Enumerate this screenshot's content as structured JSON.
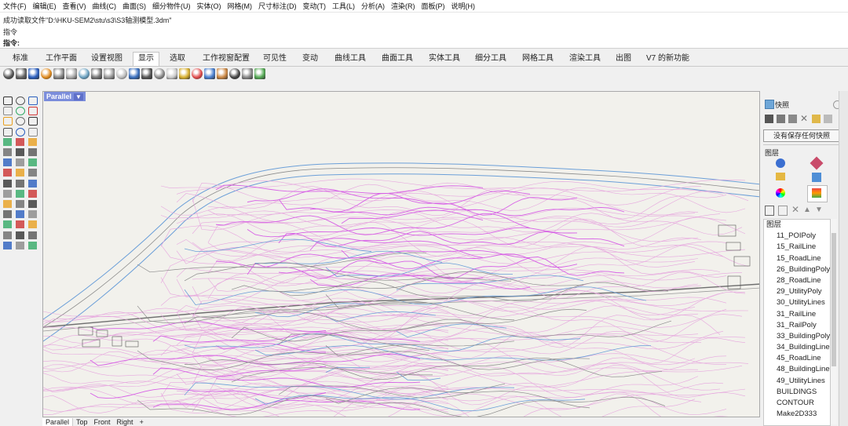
{
  "menu": [
    "文件(F)",
    "编辑(E)",
    "查看(V)",
    "曲线(C)",
    "曲面(S)",
    "细分物件(U)",
    "实体(O)",
    "网格(M)",
    "尺寸标注(D)",
    "变动(T)",
    "工具(L)",
    "分析(A)",
    "渲染(R)",
    "面板(P)",
    "说明(H)"
  ],
  "command": {
    "line1": "成功读取文件\"D:\\HKU-SEM2\\stu\\s3\\S3轴测模型.3dm\"",
    "line2": "指令",
    "line3": "指令:"
  },
  "tabs": [
    "标准",
    "工作平面",
    "设置视图",
    "显示",
    "选取",
    "工作视窗配置",
    "可见性",
    "变动",
    "曲线工具",
    "曲面工具",
    "实体工具",
    "细分工具",
    "网格工具",
    "渲染工具",
    "出图",
    "V7 的新功能"
  ],
  "active_tab": "显示",
  "viewport": {
    "label": "Parallel",
    "bottom_tabs": [
      "Parallel",
      "Top",
      "Front",
      "Right",
      "+"
    ]
  },
  "right_panel": {
    "snapshot_title": "快照",
    "snapshot_button": "没有保存任何快照",
    "layer_panel_title": "图层",
    "layer_list_title": "图层",
    "layers": [
      "11_POIPoly",
      "15_RailLine",
      "15_RoadLine",
      "26_BuildingPoly",
      "28_RoadLine",
      "29_UtilityPoly",
      "30_UtilityLines",
      "31_RailLine",
      "31_RailPoly",
      "33_BuildingPoly",
      "34_BuildingLine",
      "45_RoadLine",
      "48_BuildingLine",
      "49_UtilityLines",
      "BUILDINGS",
      "CONTOUR",
      "Make2D333"
    ]
  },
  "colors": {
    "viewport_bg": "#f2f1ec",
    "contour_pink": "#e080e8",
    "water_blue": "#6b9fd8",
    "road_gray": "#7d7d7d",
    "label_bg": "#7b8ddb"
  }
}
